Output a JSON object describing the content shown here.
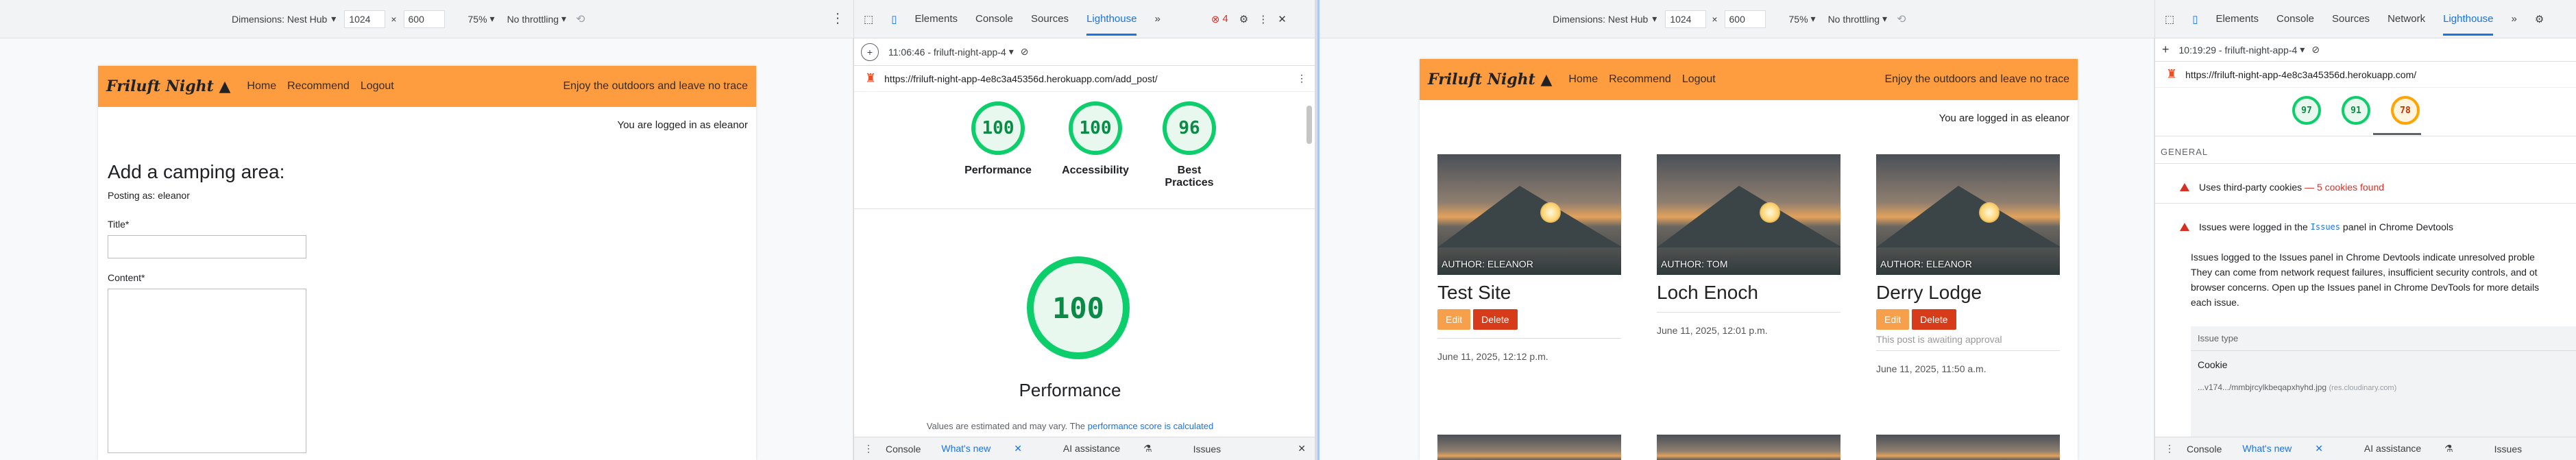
{
  "left": {
    "toolbar": {
      "dimensions_label": "Dimensions: Nest Hub",
      "width": "1024",
      "height": "600",
      "zoom": "75%",
      "throttle": "No throttling"
    },
    "site": {
      "brand": "Friluft Night",
      "nav": [
        "Home",
        "Recommend",
        "Logout"
      ],
      "tagline": "Enjoy the outdoors and leave no trace",
      "logged_in": "You are logged in as eleanor",
      "heading": "Add a camping area:",
      "posting_as": "Posting as: eleanor",
      "title_label": "Title*",
      "content_label": "Content*"
    },
    "devtools": {
      "tabs": [
        "Elements",
        "Console",
        "Sources",
        "Lighthouse"
      ],
      "error_count": "4",
      "report_time": "11:06:46 - friluft-night-app-4",
      "url": "https://friluft-night-app-4e8c3a45356d.herokuapp.com/add_post/",
      "scores": [
        {
          "value": "100",
          "label": "Performance",
          "color": "good"
        },
        {
          "value": "100",
          "label": "Accessibility",
          "color": "good"
        },
        {
          "value": "96",
          "label": "Best Practices",
          "color": "good"
        }
      ],
      "big_score": "100",
      "big_label": "Performance",
      "note": "Values are estimated and may vary. The",
      "note_link": "performance score is calculated",
      "drawer": [
        "Console",
        "What's new",
        "AI assistance",
        "Issues"
      ]
    }
  },
  "right": {
    "toolbar": {
      "dimensions_label": "Dimensions: Nest Hub",
      "width": "1024",
      "height": "600",
      "zoom": "75%",
      "throttle": "No throttling"
    },
    "site": {
      "brand": "Friluft Night",
      "nav": [
        "Home",
        "Recommend",
        "Logout"
      ],
      "tagline": "Enjoy the outdoors and leave no trace",
      "logged_in": "You are logged in as eleanor",
      "cards": [
        {
          "author": "AUTHOR: ELEANOR",
          "title": "Test Site",
          "date": "June 11, 2025, 12:12 p.m.",
          "edit": "Edit",
          "delete": "Delete",
          "note": ""
        },
        {
          "author": "AUTHOR: TOM",
          "title": "Loch Enoch",
          "date": "June 11, 2025, 12:01 p.m.",
          "edit": "",
          "delete": "",
          "note": ""
        },
        {
          "author": "AUTHOR: ELEANOR",
          "title": "Derry Lodge",
          "date": "June 11, 2025, 11:50 a.m.",
          "edit": "Edit",
          "delete": "Delete",
          "note": "This post is awaiting approval"
        }
      ]
    },
    "devtools": {
      "tabs": [
        "Elements",
        "Console",
        "Sources",
        "Network",
        "Lighthouse"
      ],
      "report_time": "10:19:29 - friluft-night-app-4",
      "url": "https://friluft-night-app-4e8c3a45356d.herokuapp.com/",
      "scores": [
        {
          "value": "97",
          "color": "good"
        },
        {
          "value": "91",
          "color": "good"
        },
        {
          "value": "78",
          "color": "average"
        }
      ],
      "section": "GENERAL",
      "issue1": "Uses third-party cookies",
      "issue1_extra": "— 5 cookies found",
      "issue2_pre": "Issues were logged in the",
      "issue2_code": "Issues",
      "issue2_post": "panel in Chrome Devtools",
      "desc1": "Issues logged to the Issues panel in Chrome Devtools indicate unresolved proble",
      "desc2": "They can come from network request failures, insufficient security controls, and ot",
      "desc3": "browser concerns. Open up the Issues panel in Chrome DevTools for more details",
      "desc4": "each issue.",
      "issue_type_label": "Issue type",
      "cookie_label": "Cookie",
      "cookie_url": "...v174.../mmbjrcylkbeqapxhyhd.jpg",
      "cookie_host": "(res.cloudinary.com)",
      "drawer": [
        "Console",
        "What's new",
        "AI assistance",
        "Issues"
      ]
    }
  }
}
